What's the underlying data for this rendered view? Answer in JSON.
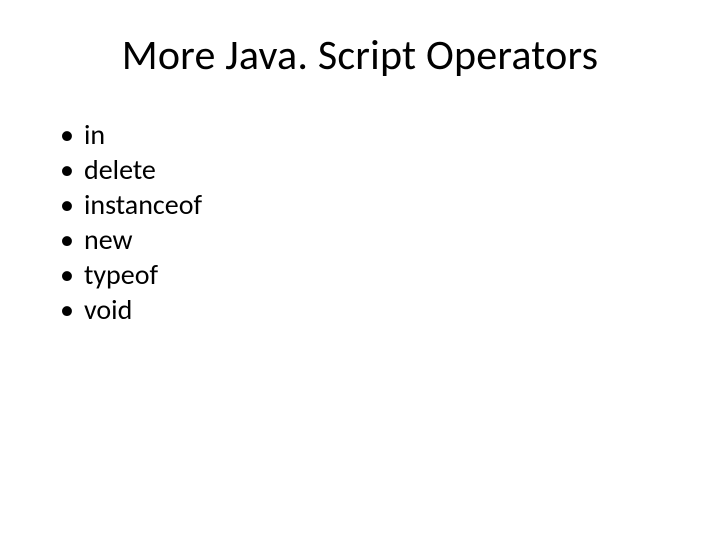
{
  "title": "More Java. Script Operators",
  "bullets": [
    "in",
    "delete",
    "instanceof",
    "new",
    "typeof",
    "void"
  ]
}
